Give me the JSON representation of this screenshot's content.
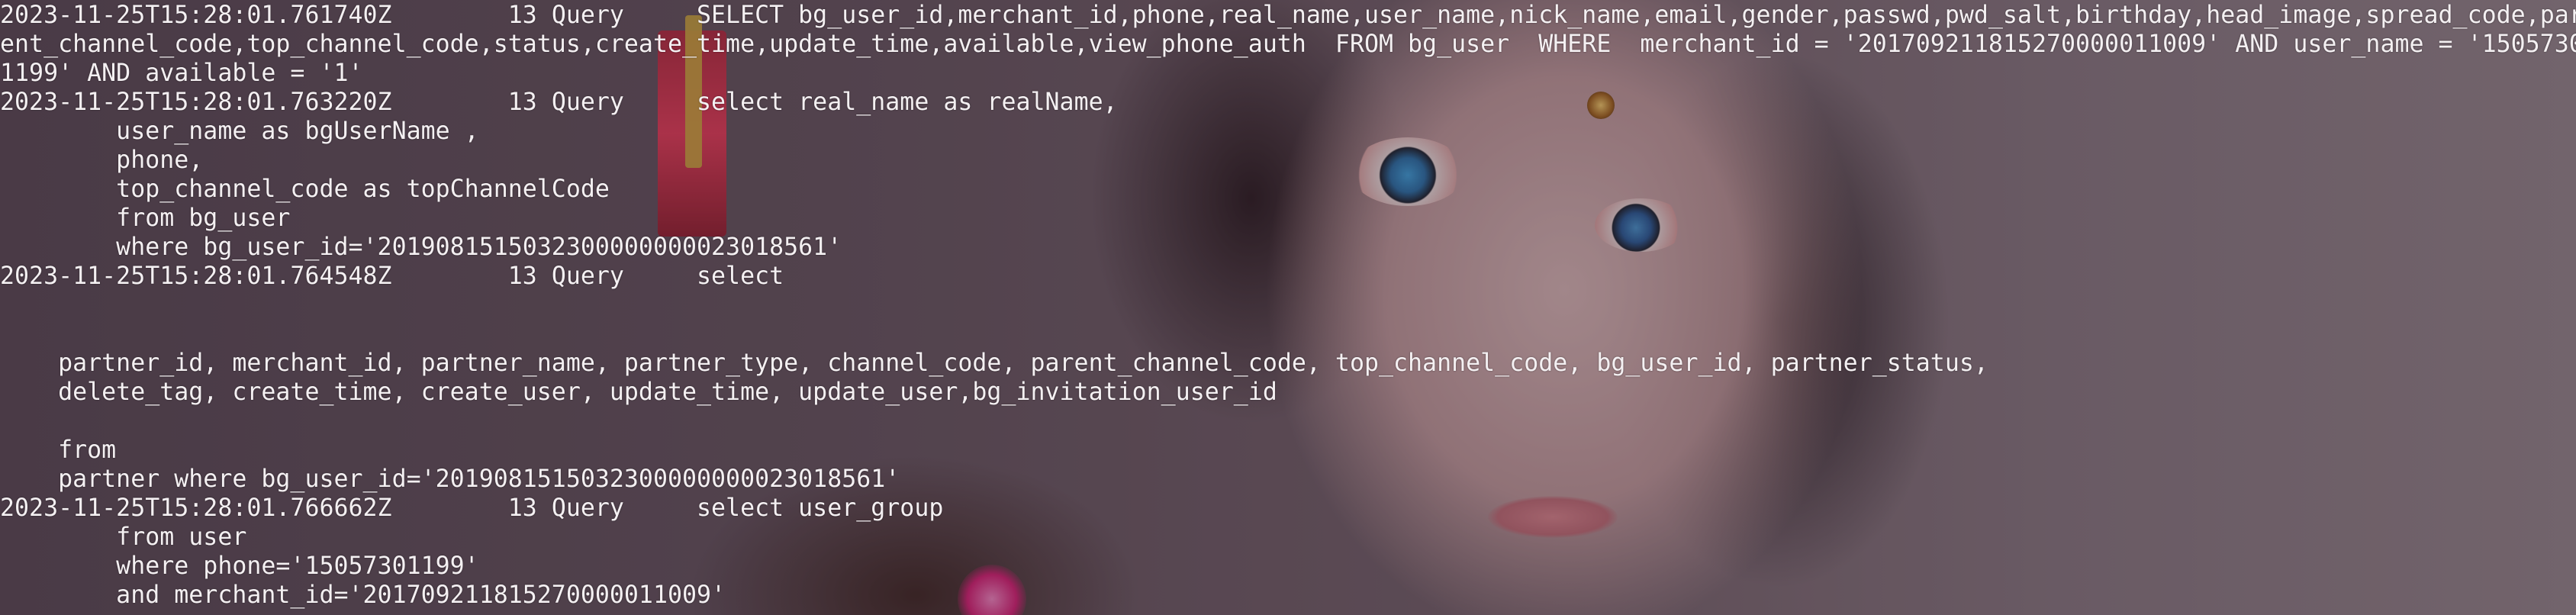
{
  "terminal": {
    "lines": [
      "2023-11-25T15:28:01.761740Z\t   13 Query\tSELECT bg_user_id,merchant_id,phone,real_name,user_name,nick_name,email,gender,passwd,pwd_salt,birthday,head_image,spread_code,par",
      "ent_channel_code,top_channel_code,status,create_time,update_time,available,view_phone_auth  FROM bg_user  WHERE  merchant_id = '201709211815270000011009' AND user_name = '1505730",
      "1199' AND available = '1'",
      "2023-11-25T15:28:01.763220Z\t   13 Query\tselect real_name as realName,",
      "        user_name as bgUserName ,",
      "        phone,",
      "        top_channel_code as topChannelCode",
      "        from bg_user",
      "        where bg_user_id='2019081515032300000000023018561'",
      "2023-11-25T15:28:01.764548Z\t   13 Query\tselect",
      "",
      "",
      "    partner_id, merchant_id, partner_name, partner_type, channel_code, parent_channel_code, top_channel_code, bg_user_id, partner_status,",
      "    delete_tag, create_time, create_user, update_time, update_user,bg_invitation_user_id",
      "",
      "    from",
      "    partner where bg_user_id='2019081515032300000000023018561'",
      "2023-11-25T15:28:01.766662Z\t   13 Query\tselect user_group",
      "        from user",
      "        where phone='15057301199'",
      "        and merchant_id='201709211815270000011009'"
    ]
  }
}
